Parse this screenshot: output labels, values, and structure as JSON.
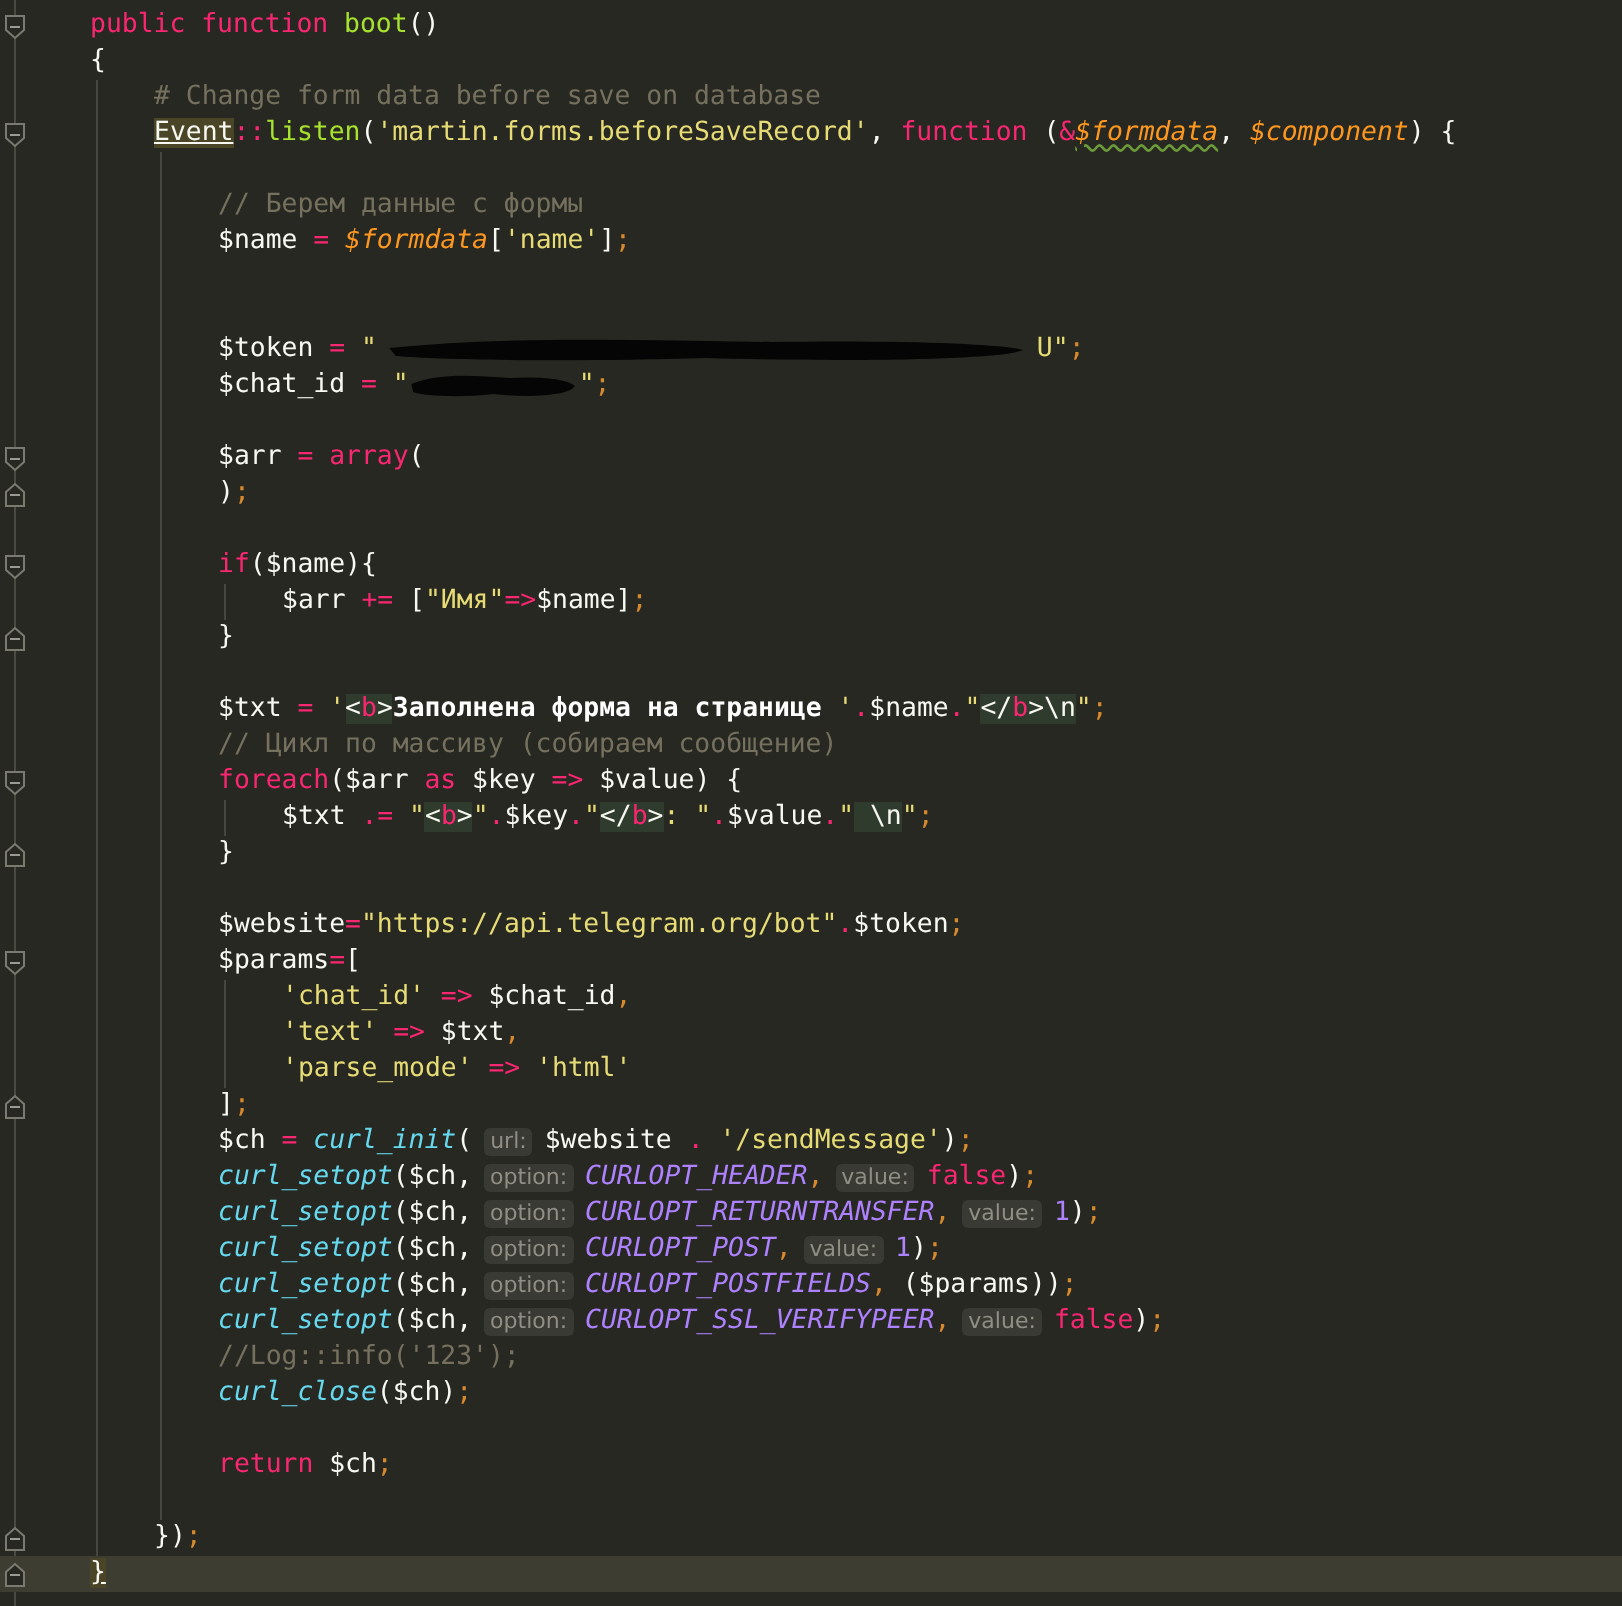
{
  "editor": {
    "lines": [
      {
        "kind": "fold-start",
        "tokens": [
          {
            "kind": "keyword",
            "text": "public "
          },
          {
            "kind": "keyword",
            "text": "function "
          },
          {
            "kind": "function",
            "text": "boot"
          },
          {
            "kind": "plain",
            "text": "()"
          }
        ]
      },
      {
        "kind": "code",
        "tokens": [
          {
            "kind": "plain",
            "text": "{"
          }
        ],
        "children": [
          {
            "kind": "code",
            "tokens": [
              {
                "kind": "comment",
                "text": "# Change form data before save on database"
              }
            ]
          },
          {
            "kind": "fold-start",
            "tokens": [
              {
                "kind": "match",
                "text": "Event"
              },
              {
                "kind": "operator",
                "text": "::"
              },
              {
                "kind": "function",
                "text": "listen"
              },
              {
                "kind": "plain",
                "text": "("
              },
              {
                "kind": "string",
                "text": "'martin.forms.beforeSaveRecord'"
              },
              {
                "kind": "plain",
                "text": ", "
              },
              {
                "kind": "keyword",
                "text": "function"
              },
              {
                "kind": "plain",
                "text": " ("
              },
              {
                "kind": "operator",
                "text": "&"
              },
              {
                "kind": "variable-warning",
                "text": "$formdata"
              },
              {
                "kind": "plain",
                "text": ", "
              },
              {
                "kind": "variable",
                "text": "$component"
              },
              {
                "kind": "plain",
                "text": ") {"
              }
            ],
            "children": [
              {
                "kind": "blank"
              },
              {
                "kind": "code",
                "tokens": [
                  {
                    "kind": "comment",
                    "text": "// Берем данные с формы"
                  }
                ]
              },
              {
                "kind": "code",
                "tokens": [
                  {
                    "kind": "plain",
                    "text": "$name"
                  },
                  {
                    "kind": "operator",
                    "text": " = "
                  },
                  {
                    "kind": "variable",
                    "text": "$formdata"
                  },
                  {
                    "kind": "plain",
                    "text": "["
                  },
                  {
                    "kind": "string",
                    "text": "'name'"
                  },
                  {
                    "kind": "plain",
                    "text": "]"
                  },
                  {
                    "kind": "punctuation",
                    "text": ";"
                  }
                ]
              },
              {
                "kind": "blank"
              },
              {
                "kind": "blank"
              },
              {
                "kind": "code",
                "tokens": [
                  {
                    "kind": "plain",
                    "text": "$token"
                  },
                  {
                    "kind": "operator",
                    "text": " = "
                  },
                  {
                    "kind": "string",
                    "text": "\""
                  },
                  {
                    "kind": "redaction-long"
                  },
                  {
                    "kind": "string",
                    "text": "U\""
                  },
                  {
                    "kind": "punctuation",
                    "text": ";"
                  }
                ]
              },
              {
                "kind": "code",
                "tokens": [
                  {
                    "kind": "plain",
                    "text": "$chat_id"
                  },
                  {
                    "kind": "operator",
                    "text": " = "
                  },
                  {
                    "kind": "string",
                    "text": "\""
                  },
                  {
                    "kind": "redaction-short"
                  },
                  {
                    "kind": "string",
                    "text": "\""
                  },
                  {
                    "kind": "punctuation",
                    "text": ";"
                  }
                ]
              },
              {
                "kind": "blank"
              },
              {
                "kind": "fold-start",
                "tokens": [
                  {
                    "kind": "plain",
                    "text": "$arr"
                  },
                  {
                    "kind": "operator",
                    "text": " = "
                  },
                  {
                    "kind": "keyword",
                    "text": "array"
                  },
                  {
                    "kind": "plain",
                    "text": "("
                  }
                ]
              },
              {
                "kind": "fold-end",
                "tokens": [
                  {
                    "kind": "plain",
                    "text": ")"
                  },
                  {
                    "kind": "punctuation",
                    "text": ";"
                  }
                ]
              },
              {
                "kind": "blank"
              },
              {
                "kind": "fold-start",
                "tokens": [
                  {
                    "kind": "keyword",
                    "text": "if"
                  },
                  {
                    "kind": "plain",
                    "text": "($name){"
                  }
                ],
                "children": [
                  {
                    "kind": "code",
                    "tokens": [
                      {
                        "kind": "plain",
                        "text": "$arr "
                      },
                      {
                        "kind": "operator",
                        "text": "+="
                      },
                      {
                        "kind": "plain",
                        "text": " ["
                      },
                      {
                        "kind": "string",
                        "text": "\"Имя\""
                      },
                      {
                        "kind": "operator",
                        "text": "=>"
                      },
                      {
                        "kind": "plain",
                        "text": "$name]"
                      },
                      {
                        "kind": "punctuation",
                        "text": ";"
                      }
                    ]
                  }
                ]
              },
              {
                "kind": "fold-end",
                "tokens": [
                  {
                    "kind": "plain",
                    "text": "}"
                  }
                ]
              },
              {
                "kind": "blank"
              },
              {
                "kind": "code",
                "tokens": [
                  {
                    "kind": "plain",
                    "text": "$txt"
                  },
                  {
                    "kind": "operator",
                    "text": " = "
                  },
                  {
                    "kind": "string",
                    "text": "'"
                  },
                  {
                    "kind": "html-tag",
                    "text": "<"
                  },
                  {
                    "kind": "html-tag-name",
                    "text": "b"
                  },
                  {
                    "kind": "html-tag",
                    "text": ">"
                  },
                  {
                    "kind": "html-text",
                    "text": "Заполнена форма на странице "
                  },
                  {
                    "kind": "string",
                    "text": "'"
                  },
                  {
                    "kind": "operator",
                    "text": "."
                  },
                  {
                    "kind": "plain",
                    "text": "$name"
                  },
                  {
                    "kind": "operator",
                    "text": "."
                  },
                  {
                    "kind": "string",
                    "text": "\""
                  },
                  {
                    "kind": "html-tag",
                    "text": "</"
                  },
                  {
                    "kind": "html-tag-name",
                    "text": "b"
                  },
                  {
                    "kind": "html-tag",
                    "text": ">\\n"
                  },
                  {
                    "kind": "string",
                    "text": "\""
                  },
                  {
                    "kind": "punctuation",
                    "text": ";"
                  }
                ]
              },
              {
                "kind": "code",
                "tokens": [
                  {
                    "kind": "comment",
                    "text": "// Цикл по массиву (собираем сообщение)"
                  }
                ]
              },
              {
                "kind": "fold-start",
                "tokens": [
                  {
                    "kind": "keyword",
                    "text": "foreach"
                  },
                  {
                    "kind": "plain",
                    "text": "($arr "
                  },
                  {
                    "kind": "keyword",
                    "text": "as"
                  },
                  {
                    "kind": "plain",
                    "text": " $key "
                  },
                  {
                    "kind": "operator",
                    "text": "=>"
                  },
                  {
                    "kind": "plain",
                    "text": " $value) {"
                  }
                ],
                "children": [
                  {
                    "kind": "code",
                    "tokens": [
                      {
                        "kind": "plain",
                        "text": "$txt "
                      },
                      {
                        "kind": "operator",
                        "text": ".= "
                      },
                      {
                        "kind": "string",
                        "text": "\""
                      },
                      {
                        "kind": "html-tag",
                        "text": "<"
                      },
                      {
                        "kind": "html-tag-name",
                        "text": "b"
                      },
                      {
                        "kind": "html-tag",
                        "text": ">"
                      },
                      {
                        "kind": "string",
                        "text": "\""
                      },
                      {
                        "kind": "operator",
                        "text": "."
                      },
                      {
                        "kind": "plain",
                        "text": "$key"
                      },
                      {
                        "kind": "operator",
                        "text": "."
                      },
                      {
                        "kind": "string",
                        "text": "\""
                      },
                      {
                        "kind": "html-tag",
                        "text": "</"
                      },
                      {
                        "kind": "html-tag-name",
                        "text": "b"
                      },
                      {
                        "kind": "html-tag",
                        "text": ">"
                      },
                      {
                        "kind": "string",
                        "text": ": \""
                      },
                      {
                        "kind": "operator",
                        "text": "."
                      },
                      {
                        "kind": "plain",
                        "text": "$value"
                      },
                      {
                        "kind": "operator",
                        "text": "."
                      },
                      {
                        "kind": "string",
                        "text": "\""
                      },
                      {
                        "kind": "html-tag",
                        "text": " \\n"
                      },
                      {
                        "kind": "string",
                        "text": "\""
                      },
                      {
                        "kind": "punctuation",
                        "text": ";"
                      }
                    ]
                  }
                ]
              },
              {
                "kind": "fold-end",
                "tokens": [
                  {
                    "kind": "plain",
                    "text": "}"
                  }
                ]
              },
              {
                "kind": "blank"
              },
              {
                "kind": "code",
                "tokens": [
                  {
                    "kind": "plain",
                    "text": "$website"
                  },
                  {
                    "kind": "operator",
                    "text": "="
                  },
                  {
                    "kind": "string",
                    "text": "\"https://api.telegram.org/bot\""
                  },
                  {
                    "kind": "operator",
                    "text": "."
                  },
                  {
                    "kind": "plain",
                    "text": "$token"
                  },
                  {
                    "kind": "punctuation",
                    "text": ";"
                  }
                ]
              },
              {
                "kind": "fold-start",
                "tokens": [
                  {
                    "kind": "plain",
                    "text": "$params"
                  },
                  {
                    "kind": "operator",
                    "text": "="
                  },
                  {
                    "kind": "plain",
                    "text": "["
                  }
                ],
                "children": [
                  {
                    "kind": "code",
                    "tokens": [
                      {
                        "kind": "string",
                        "text": "'chat_id'"
                      },
                      {
                        "kind": "operator",
                        "text": " => "
                      },
                      {
                        "kind": "plain",
                        "text": "$chat_id"
                      },
                      {
                        "kind": "punctuation",
                        "text": ","
                      }
                    ]
                  },
                  {
                    "kind": "code",
                    "tokens": [
                      {
                        "kind": "string",
                        "text": "'text'"
                      },
                      {
                        "kind": "operator",
                        "text": " => "
                      },
                      {
                        "kind": "plain",
                        "text": "$txt"
                      },
                      {
                        "kind": "punctuation",
                        "text": ","
                      }
                    ]
                  },
                  {
                    "kind": "code",
                    "tokens": [
                      {
                        "kind": "string",
                        "text": "'parse_mode'"
                      },
                      {
                        "kind": "operator",
                        "text": " => "
                      },
                      {
                        "kind": "string",
                        "text": "'html'"
                      }
                    ]
                  }
                ]
              },
              {
                "kind": "fold-end",
                "tokens": [
                  {
                    "kind": "plain",
                    "text": "]"
                  },
                  {
                    "kind": "punctuation",
                    "text": ";"
                  }
                ]
              },
              {
                "kind": "code",
                "tokens": [
                  {
                    "kind": "plain",
                    "text": "$ch"
                  },
                  {
                    "kind": "operator",
                    "text": " = "
                  },
                  {
                    "kind": "call",
                    "text": "curl_init"
                  },
                  {
                    "kind": "plain",
                    "text": "("
                  },
                  {
                    "kind": "hint",
                    "text": "url:"
                  },
                  {
                    "kind": "plain",
                    "text": "$website "
                  },
                  {
                    "kind": "operator",
                    "text": ". "
                  },
                  {
                    "kind": "string",
                    "text": "'/sendMessage'"
                  },
                  {
                    "kind": "plain",
                    "text": ")"
                  },
                  {
                    "kind": "punctuation",
                    "text": ";"
                  }
                ]
              },
              {
                "kind": "code",
                "tokens": [
                  {
                    "kind": "call",
                    "text": "curl_setopt"
                  },
                  {
                    "kind": "plain",
                    "text": "($ch,"
                  },
                  {
                    "kind": "hint",
                    "text": "option:"
                  },
                  {
                    "kind": "constant",
                    "text": "CURLOPT_HEADER"
                  },
                  {
                    "kind": "punctuation",
                    "text": ","
                  },
                  {
                    "kind": "hint",
                    "text": "value:"
                  },
                  {
                    "kind": "keyword",
                    "text": "false"
                  },
                  {
                    "kind": "plain",
                    "text": ")"
                  },
                  {
                    "kind": "punctuation",
                    "text": ";"
                  }
                ]
              },
              {
                "kind": "code",
                "tokens": [
                  {
                    "kind": "call",
                    "text": "curl_setopt"
                  },
                  {
                    "kind": "plain",
                    "text": "($ch,"
                  },
                  {
                    "kind": "hint",
                    "text": "option:"
                  },
                  {
                    "kind": "constant",
                    "text": "CURLOPT_RETURNTRANSFER"
                  },
                  {
                    "kind": "punctuation",
                    "text": ","
                  },
                  {
                    "kind": "hint",
                    "text": "value:"
                  },
                  {
                    "kind": "number",
                    "text": "1"
                  },
                  {
                    "kind": "plain",
                    "text": ")"
                  },
                  {
                    "kind": "punctuation",
                    "text": ";"
                  }
                ]
              },
              {
                "kind": "code",
                "tokens": [
                  {
                    "kind": "call",
                    "text": "curl_setopt"
                  },
                  {
                    "kind": "plain",
                    "text": "($ch,"
                  },
                  {
                    "kind": "hint",
                    "text": "option:"
                  },
                  {
                    "kind": "constant",
                    "text": "CURLOPT_POST"
                  },
                  {
                    "kind": "punctuation",
                    "text": ","
                  },
                  {
                    "kind": "hint",
                    "text": "value:"
                  },
                  {
                    "kind": "number",
                    "text": "1"
                  },
                  {
                    "kind": "plain",
                    "text": ")"
                  },
                  {
                    "kind": "punctuation",
                    "text": ";"
                  }
                ]
              },
              {
                "kind": "code",
                "tokens": [
                  {
                    "kind": "call",
                    "text": "curl_setopt"
                  },
                  {
                    "kind": "plain",
                    "text": "($ch,"
                  },
                  {
                    "kind": "hint",
                    "text": "option:"
                  },
                  {
                    "kind": "constant",
                    "text": "CURLOPT_POSTFIELDS"
                  },
                  {
                    "kind": "punctuation",
                    "text": ","
                  },
                  {
                    "kind": "plain",
                    "text": " ($params))"
                  },
                  {
                    "kind": "punctuation",
                    "text": ";"
                  }
                ]
              },
              {
                "kind": "code",
                "tokens": [
                  {
                    "kind": "call",
                    "text": "curl_setopt"
                  },
                  {
                    "kind": "plain",
                    "text": "($ch,"
                  },
                  {
                    "kind": "hint",
                    "text": "option:"
                  },
                  {
                    "kind": "constant",
                    "text": "CURLOPT_SSL_VERIFYPEER"
                  },
                  {
                    "kind": "punctuation",
                    "text": ","
                  },
                  {
                    "kind": "hint",
                    "text": "value:"
                  },
                  {
                    "kind": "keyword",
                    "text": "false"
                  },
                  {
                    "kind": "plain",
                    "text": ")"
                  },
                  {
                    "kind": "punctuation",
                    "text": ";"
                  }
                ]
              },
              {
                "kind": "code",
                "tokens": [
                  {
                    "kind": "comment",
                    "text": "//Log::info('123');"
                  }
                ]
              },
              {
                "kind": "code",
                "tokens": [
                  {
                    "kind": "call",
                    "text": "curl_close"
                  },
                  {
                    "kind": "plain",
                    "text": "($ch)"
                  },
                  {
                    "kind": "punctuation",
                    "text": ";"
                  }
                ]
              },
              {
                "kind": "blank"
              },
              {
                "kind": "code",
                "tokens": [
                  {
                    "kind": "keyword",
                    "text": "return"
                  },
                  {
                    "kind": "plain",
                    "text": " $ch"
                  },
                  {
                    "kind": "punctuation",
                    "text": ";"
                  }
                ]
              },
              {
                "kind": "blank"
              }
            ]
          },
          {
            "kind": "fold-end",
            "tokens": [
              {
                "kind": "plain",
                "text": "})"
              },
              {
                "kind": "punctuation",
                "text": ";"
              }
            ]
          }
        ]
      },
      {
        "kind": "fold-end",
        "current": true,
        "tokens": [
          {
            "kind": "match",
            "text": "}"
          }
        ]
      }
    ]
  }
}
